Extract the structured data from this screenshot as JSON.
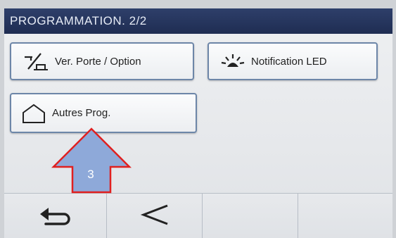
{
  "header": {
    "title": "PROGRAMMATION. 2/2"
  },
  "buttons": {
    "door_option": {
      "label": "Ver. Porte / Option",
      "icon": "door-lock-icon"
    },
    "led_notification": {
      "label": "Notification LED",
      "icon": "led-light-icon"
    },
    "other_prog": {
      "label": "Autres Prog.",
      "icon": "home-icon"
    }
  },
  "annotation": {
    "label": "3",
    "fill_color": "#8ea9d9",
    "border_color": "#e02020"
  },
  "nav": {
    "back_icon": "return-arrow-icon",
    "prev_icon": "chevron-left-icon"
  }
}
